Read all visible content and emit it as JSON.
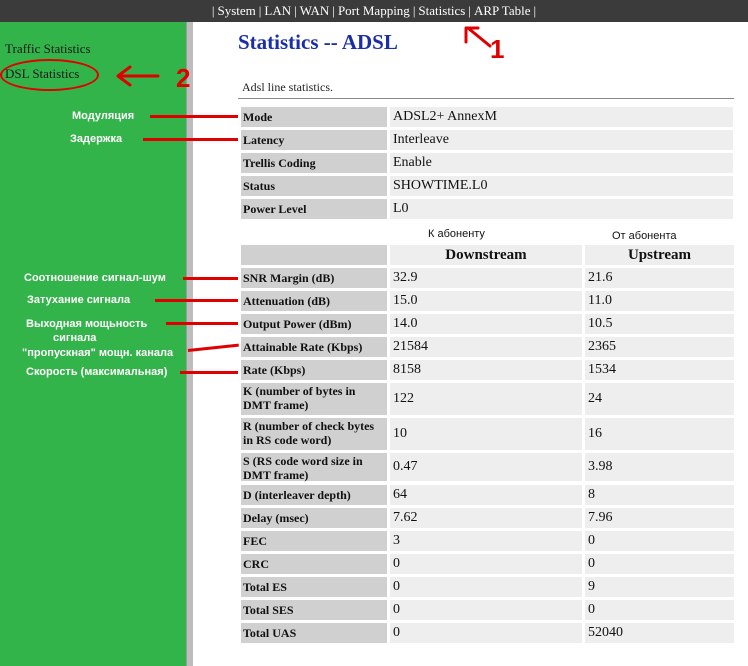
{
  "nav": {
    "items": [
      {
        "label": "System"
      },
      {
        "label": "LAN"
      },
      {
        "label": "WAN"
      },
      {
        "label": "Port Mapping"
      },
      {
        "label": "Statistics"
      },
      {
        "label": "ARP Table"
      }
    ],
    "separator": "|"
  },
  "sidebar": {
    "items": [
      {
        "label": "Traffic Statistics"
      },
      {
        "label": "DSL Statistics"
      }
    ]
  },
  "page": {
    "title": "Statistics -- ADSL",
    "description": "Adsl line statistics."
  },
  "line_info": [
    {
      "label": "Mode",
      "value": "ADSL2+ AnnexM"
    },
    {
      "label": "Latency",
      "value": "Interleave"
    },
    {
      "label": "Trellis Coding",
      "value": "Enable"
    },
    {
      "label": "Status",
      "value": "SHOWTIME.L0"
    },
    {
      "label": "Power Level",
      "value": "L0"
    }
  ],
  "stats_header": {
    "downstream_ru": "К абоненту",
    "upstream_ru": "От абонента",
    "downstream": "Downstream",
    "upstream": "Upstream"
  },
  "stats": [
    {
      "label": "SNR Margin (dB)",
      "down": "32.9",
      "up": "21.6"
    },
    {
      "label": "Attenuation (dB)",
      "down": "15.0",
      "up": "11.0"
    },
    {
      "label": "Output Power (dBm)",
      "down": "14.0",
      "up": "10.5"
    },
    {
      "label": "Attainable Rate (Kbps)",
      "down": "21584",
      "up": "2365"
    },
    {
      "label": "Rate (Kbps)",
      "down": "8158",
      "up": "1534"
    },
    {
      "label": "K (number of bytes in DMT frame)",
      "down": "122",
      "up": "24"
    },
    {
      "label": "R (number of check bytes in RS code word)",
      "down": "10",
      "up": "16"
    },
    {
      "label": "S (RS code word size in DMT frame)",
      "down": "0.47",
      "up": "3.98"
    },
    {
      "label": "D (interleaver depth)",
      "down": "64",
      "up": "8"
    },
    {
      "label": "Delay (msec)",
      "down": "7.62",
      "up": "7.96"
    },
    {
      "label": "FEC",
      "down": "3",
      "up": "0"
    },
    {
      "label": "CRC",
      "down": "0",
      "up": "0"
    },
    {
      "label": "Total ES",
      "down": "0",
      "up": "9"
    },
    {
      "label": "Total SES",
      "down": "0",
      "up": "0"
    },
    {
      "label": "Total UAS",
      "down": "0",
      "up": "52040"
    }
  ],
  "annotations": {
    "mode": "Модуляция",
    "latency": "Задержка",
    "snr": "Соотношение сигнал-шум",
    "attenuation": "Затухание сигнала",
    "output_power_1": "Выходная мощьность",
    "output_power_2": "сигнала",
    "attainable_1": "\"пропускная\" мощн. канала",
    "rate": "Скорость (максимальная)",
    "marker_1": "1",
    "marker_2": "2"
  },
  "colors": {
    "sidebar": "#33b44a",
    "topbar": "#3b3b3b",
    "title": "#1a2ea8",
    "annotation": "#e00000"
  }
}
